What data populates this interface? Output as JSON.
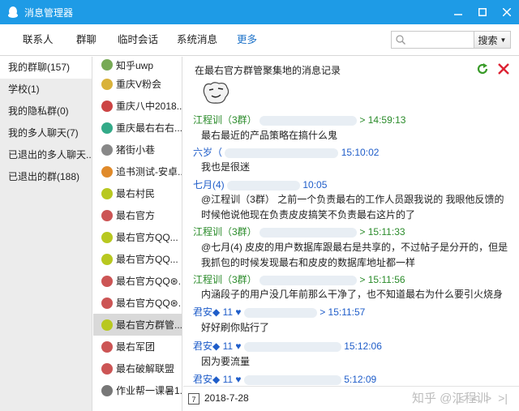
{
  "window": {
    "title": "消息管理器"
  },
  "nav": {
    "tabs": [
      "联系人",
      "群聊",
      "临时会话",
      "系统消息",
      "更多"
    ],
    "search_placeholder": "",
    "search_button": "搜索"
  },
  "left": {
    "items": [
      "我的群聊(157)",
      "学校(1)",
      "我的隐私群(0)",
      "我的多人聊天(7)",
      "已退出的多人聊天...",
      "已退出的群(188)"
    ]
  },
  "groups": {
    "items": [
      "知乎uwp",
      "重庆V粉会",
      "重庆八中2018...",
      "重庆最右右右...",
      "猪街小巷",
      "追书测试-安卓...",
      "最右村民",
      "最右官方",
      "最右官方QQ...",
      "最右官方QQ...",
      "最右官方QQ⊛...",
      "最右官方QQ⊛...",
      "最右官方群管...",
      "最右军团",
      "最右破解联盟",
      "作业帮一课暑1..."
    ]
  },
  "chat": {
    "header": "在最右官方群管聚集地的消息记录",
    "messages": [
      {
        "sender": "江程训（3群）",
        "time": "> 14:59:13",
        "text": "最右最近的产品策略在搞什么鬼"
      },
      {
        "sender": "六岁（",
        "time": "15:10:02",
        "text": "我也是很迷"
      },
      {
        "sender": "七月(4)",
        "time": "10:05",
        "text": "@江程训（3群） 之前一个负责最右的工作人员跟我说的 我眼他反馈的时候他说他现在负责皮皮搞笑不负责最右这片的了"
      },
      {
        "sender": "江程训（3群）",
        "time": "> 15:11:33",
        "text": "@七月(4) 皮皮的用户数据库跟最右是共享的，不过帖子是分开的，但是我抓包的时候发现最右和皮皮的数据库地址都一样"
      },
      {
        "sender": "江程训（3群）",
        "time": "> 15:11:56",
        "text": "内涵段子的用户没几年前那么干净了，也不知道最右为什么要引火烧身"
      },
      {
        "sender": "君安◆  11",
        "time": "> 15:11:57",
        "text": "好好刷你贴行了"
      },
      {
        "sender": "君安◆  11",
        "time": "15:12:06",
        "text": "因为要流量"
      },
      {
        "sender": "君安◆  11",
        "time": "5:12:09",
        "text": ""
      }
    ]
  },
  "footer": {
    "date": "2018-7-28",
    "watermark": "知乎 @江程训",
    "pager": [
      "|<",
      "<",
      ">",
      ">|"
    ]
  }
}
